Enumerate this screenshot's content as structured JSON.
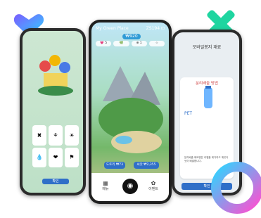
{
  "left_phone": {
    "grid_icons": [
      "✖",
      "⚘",
      "☀",
      "💧",
      "❤",
      "⚑"
    ],
    "button_label": "확인"
  },
  "center_phone": {
    "app_title": "My Green Place",
    "app_meta": "ZS194 ⊡",
    "score": "₩920",
    "stats": [
      "💗 5",
      "🌿",
      "⊕ 1",
      "☆"
    ],
    "pill_left": "도토리 ₩73",
    "pill_right": "씨앗 ₩2,355",
    "nav_left": "메뉴",
    "nav_center": "◉",
    "nav_right": "이벤트"
  },
  "right_phone": {
    "title": "모바일봉지 재료",
    "sheet_title": "분리배출 방법",
    "pet_label": "PET",
    "sheet_text": "분리배출 페트병은 라벨을 제거하고 깨끗이 씻어 배출합니다.",
    "confirm_label": "확인"
  },
  "colors": {
    "accent_blue": "#2f6fc8",
    "heart_start": "#ff4fa1",
    "heart_end": "#7b5cff",
    "cross": "#1fd5a0",
    "ring_start": "#2fd4ff",
    "ring_end": "#ff4fd1"
  }
}
